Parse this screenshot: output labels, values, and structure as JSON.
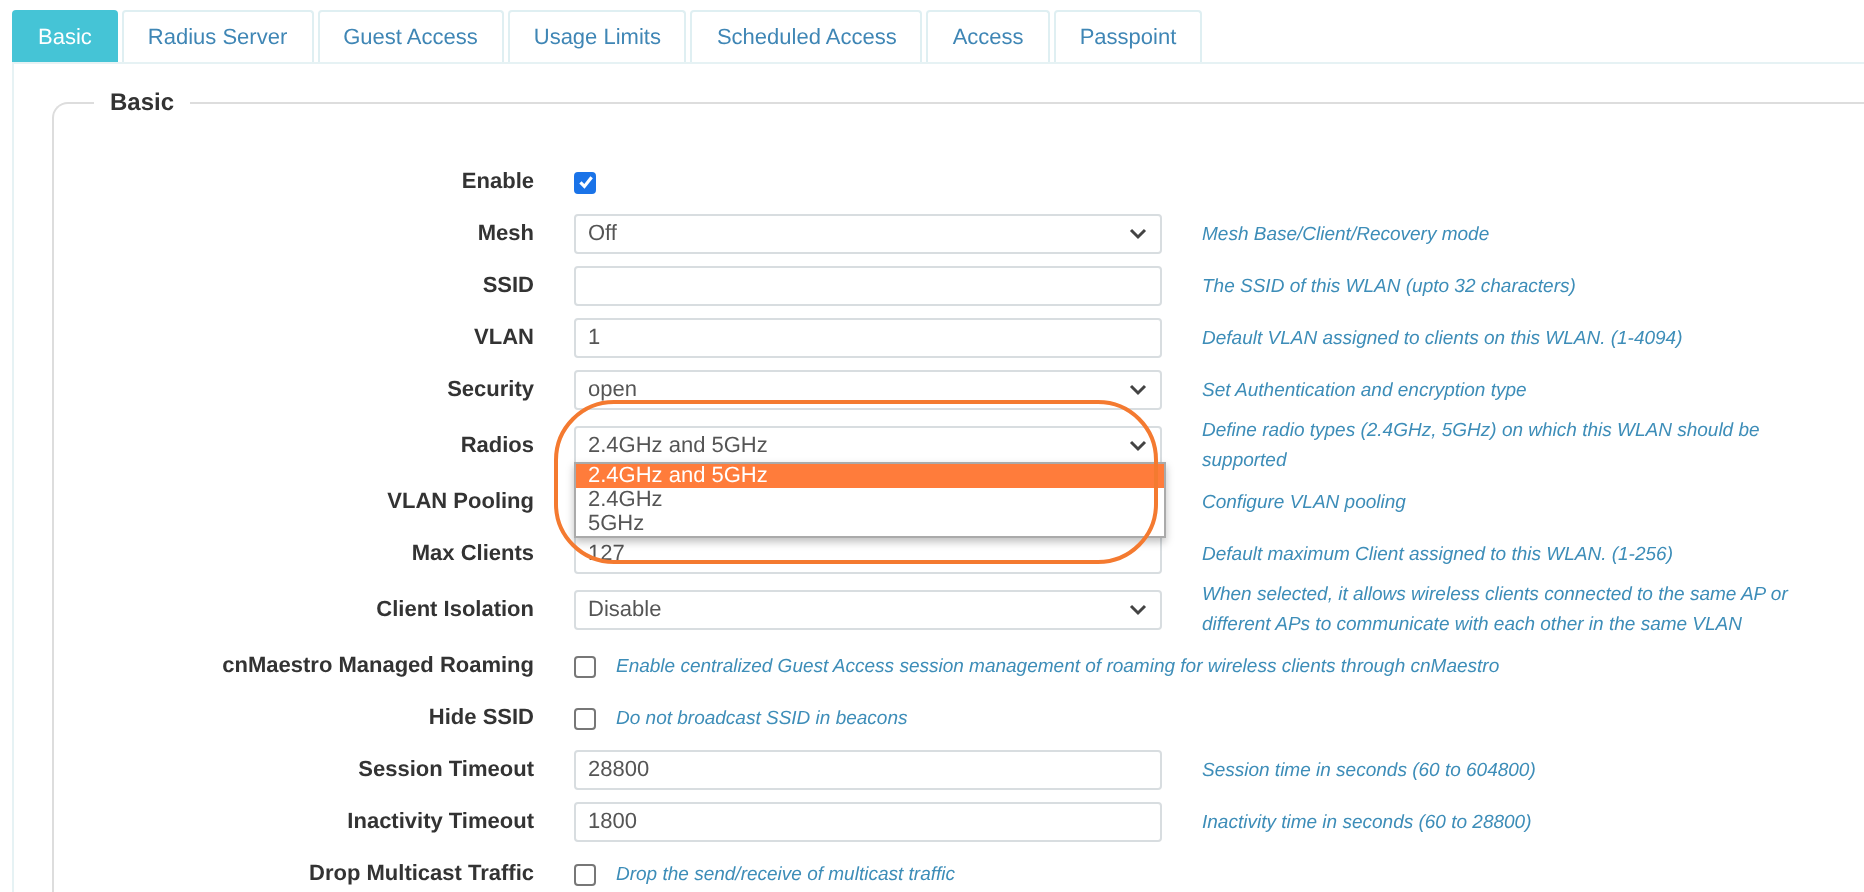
{
  "tabs": [
    {
      "label": "Basic",
      "selected": true
    },
    {
      "label": "Radius Server",
      "selected": false
    },
    {
      "label": "Guest Access",
      "selected": false
    },
    {
      "label": "Usage Limits",
      "selected": false
    },
    {
      "label": "Scheduled Access",
      "selected": false
    },
    {
      "label": "Access",
      "selected": false
    },
    {
      "label": "Passpoint",
      "selected": false
    }
  ],
  "section": {
    "title": "Basic"
  },
  "fields": [
    {
      "kind": "checkbox",
      "label": "Enable",
      "checked": true
    },
    {
      "kind": "select",
      "label": "Mesh",
      "value": "Off",
      "help": "Mesh Base/Client/Recovery mode"
    },
    {
      "kind": "text",
      "label": "SSID",
      "help": "The SSID of this WLAN (upto 32 characters)"
    },
    {
      "kind": "text",
      "label": "VLAN",
      "value": "1",
      "help": "Default VLAN assigned to clients on this WLAN. (1-4094)"
    },
    {
      "kind": "select",
      "label": "Security",
      "value": "open",
      "help": "Set Authentication and encryption type"
    },
    {
      "kind": "select",
      "label": "Radios",
      "value": "2.4GHz and 5GHz",
      "help": "Define radio types (2.4GHz, 5GHz) on which this WLAN should be supported",
      "expanded": true,
      "options": [
        {
          "label": "2.4GHz and 5GHz",
          "selected": true
        },
        {
          "label": "2.4GHz",
          "selected": false
        },
        {
          "label": "5GHz",
          "selected": false
        }
      ],
      "annotated": true
    },
    {
      "kind": "hidden",
      "label": "VLAN Pooling",
      "help": "Configure VLAN pooling"
    },
    {
      "kind": "text",
      "label": "Max Clients",
      "value": "127",
      "help": "Default maximum Client assigned to this WLAN. (1-256)"
    },
    {
      "kind": "select",
      "label": "Client Isolation",
      "value": "Disable",
      "help": "When selected, it allows wireless clients connected to the same AP or different APs to communicate with each other in the same VLAN"
    },
    {
      "kind": "checkbox",
      "label": "cnMaestro Managed Roaming",
      "checked": false,
      "help": "Enable centralized Guest Access session management of roaming for wireless clients through cnMaestro"
    },
    {
      "kind": "checkbox",
      "label": "Hide SSID",
      "checked": false,
      "help": "Do not broadcast SSID in beacons"
    },
    {
      "kind": "text",
      "label": "Session Timeout",
      "value": "28800",
      "help": "Session time in seconds (60 to 604800)"
    },
    {
      "kind": "text",
      "label": "Inactivity Timeout",
      "value": "1800",
      "help": "Inactivity time in seconds (60 to 28800)"
    },
    {
      "kind": "checkbox",
      "label": "Drop Multicast Traffic",
      "checked": false,
      "help": "Drop the send/receive of multicast traffic"
    }
  ]
}
